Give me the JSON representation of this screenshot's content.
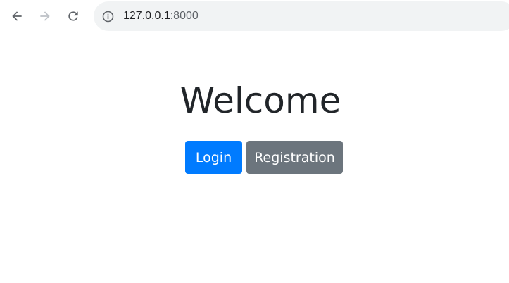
{
  "browser": {
    "url_host": "127.0.0.1",
    "url_port": ":8000",
    "icons": {
      "back": "arrow-left-icon",
      "forward": "arrow-right-icon",
      "reload": "reload-icon",
      "info": "info-icon"
    }
  },
  "page": {
    "title": "Welcome",
    "login_label": "Login",
    "registration_label": "Registration"
  },
  "colors": {
    "primary": "#007bff",
    "secondary": "#6c757d",
    "heading": "#212529"
  }
}
